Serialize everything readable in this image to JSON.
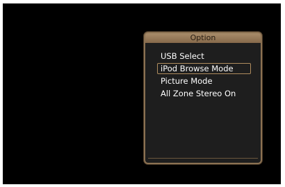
{
  "option_menu": {
    "title": "Option",
    "selected_index": 1,
    "items": [
      {
        "label": "USB Select"
      },
      {
        "label": "iPod Browse Mode"
      },
      {
        "label": "Picture Mode"
      },
      {
        "label": "All Zone Stereo On"
      }
    ]
  },
  "colors": {
    "screen_background": "#000000",
    "panel_background": "#1e1e1e",
    "panel_border": "#8b7152",
    "header_background": "#a88c6a",
    "selection_outline": "#b08d5e",
    "item_text": "#ffffff"
  }
}
